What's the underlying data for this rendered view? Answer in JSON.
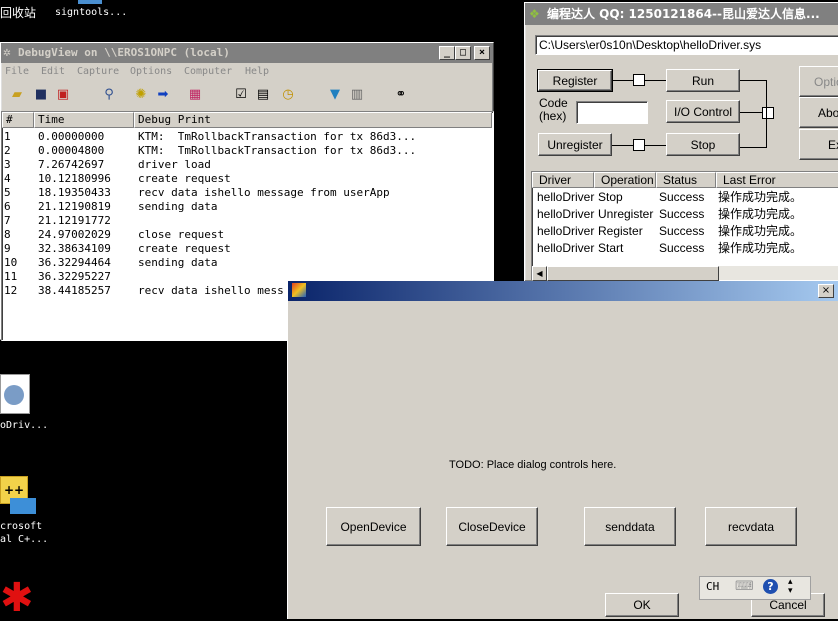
{
  "desktop": {
    "top_label_1": "回收站",
    "top_label_2": "signtools...",
    "icon_labels": [
      "oDriv...",
      "crosoft",
      "al C+..."
    ]
  },
  "debugview": {
    "title": "DebugView on \\\\EROS1ONPC (local)",
    "menu": [
      "File",
      "Edit",
      "Capture",
      "Options",
      "Computer",
      "Help"
    ],
    "columns": [
      "#",
      "Time",
      "Debug Print"
    ],
    "rows": [
      {
        "n": "1",
        "time": "0.00000000",
        "msg": "KTM:  TmRollbackTransaction for tx 86d3..."
      },
      {
        "n": "2",
        "time": "0.00004800",
        "msg": "KTM:  TmRollbackTransaction for tx 86d3..."
      },
      {
        "n": "3",
        "time": "7.26742697",
        "msg": "driver load"
      },
      {
        "n": "4",
        "time": "10.12180996",
        "msg": "create request"
      },
      {
        "n": "5",
        "time": "18.19350433",
        "msg": "recv data ishello message from userApp"
      },
      {
        "n": "6",
        "time": "21.12190819",
        "msg": "sending data"
      },
      {
        "n": "7",
        "time": "21.12191772",
        "msg": ""
      },
      {
        "n": "8",
        "time": "24.97002029",
        "msg": "close request"
      },
      {
        "n": "9",
        "time": "32.38634109",
        "msg": "create request"
      },
      {
        "n": "10",
        "time": "36.32294464",
        "msg": "sending data"
      },
      {
        "n": "11",
        "time": "36.32295227",
        "msg": ""
      },
      {
        "n": "12",
        "time": "38.44185257",
        "msg": "recv data ishello mess"
      }
    ]
  },
  "tool": {
    "title": "编程达人 QQ: 1250121864--昆山爱达人信息...",
    "path": "C:\\Users\\er0s10n\\Desktop\\helloDriver.sys",
    "register": "Register",
    "run": "Run",
    "code_label": "Code (hex)",
    "io_control": "I/O Control",
    "unregister": "Unregister",
    "stop": "Stop",
    "right_buttons": [
      "Optio",
      "Abou",
      "Ex"
    ],
    "columns": [
      "Driver",
      "Operation",
      "Status",
      "Last Error"
    ],
    "rows": [
      {
        "driver": "helloDriver",
        "op": "Stop",
        "status": "Success",
        "err": "操作成功完成。"
      },
      {
        "driver": "helloDriver",
        "op": "Unregister",
        "status": "Success",
        "err": "操作成功完成。"
      },
      {
        "driver": "helloDriver",
        "op": "Register",
        "status": "Success",
        "err": "操作成功完成。"
      },
      {
        "driver": "helloDriver",
        "op": "Start",
        "status": "Success",
        "err": "操作成功完成。"
      }
    ]
  },
  "dialog": {
    "todo": "TODO: Place dialog controls here.",
    "buttons": [
      "OpenDevice",
      "CloseDevice",
      "senddata",
      "recvdata"
    ],
    "ok": "OK",
    "cancel": "Cancel",
    "ime": "CH"
  }
}
